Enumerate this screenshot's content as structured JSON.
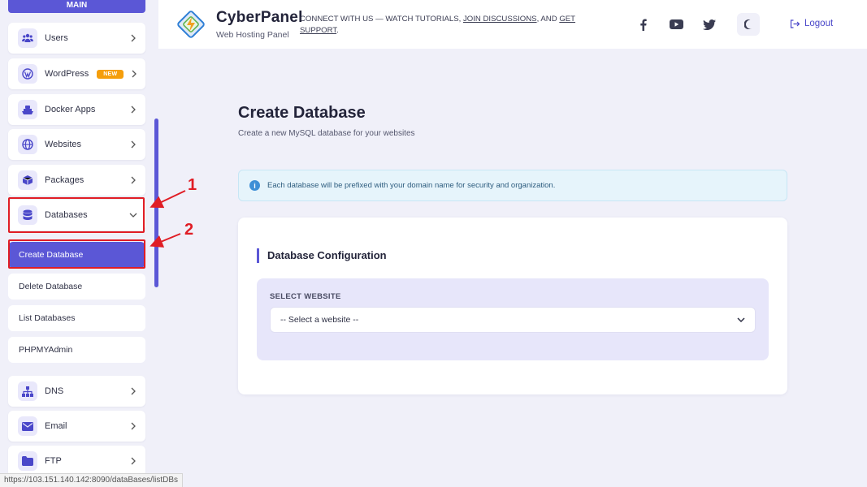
{
  "sidebar": {
    "section_label": "MAIN",
    "items": [
      {
        "label": "Users",
        "icon": "users-icon"
      },
      {
        "label": "WordPress",
        "icon": "wordpress-icon",
        "badge": "NEW"
      },
      {
        "label": "Docker Apps",
        "icon": "docker-icon"
      },
      {
        "label": "Websites",
        "icon": "globe-icon"
      },
      {
        "label": "Packages",
        "icon": "package-icon"
      },
      {
        "label": "Databases",
        "icon": "database-icon"
      }
    ],
    "sub_items": [
      {
        "label": "Create Database",
        "active": true
      },
      {
        "label": "Delete Database"
      },
      {
        "label": "List Databases"
      },
      {
        "label": "PHPMYAdmin"
      }
    ],
    "items_bottom": [
      {
        "label": "DNS",
        "icon": "sitemap-icon"
      },
      {
        "label": "Email",
        "icon": "envelope-icon"
      },
      {
        "label": "FTP",
        "icon": "folder-icon"
      }
    ]
  },
  "header": {
    "brand_title": "CyberPanel",
    "brand_subtitle": "Web Hosting Panel",
    "tagline_prefix": "CONNECT WITH US — WATCH TUTORIALS, ",
    "tagline_link1": "JOIN DISCUSSIONS",
    "tagline_mid": ", AND ",
    "tagline_link2": "GET SUPPORT",
    "tagline_suffix": ".",
    "logout_label": "Logout"
  },
  "main": {
    "title": "Create Database",
    "subtitle": "Create a new MySQL database for your websites",
    "info_text": "Each database will be prefixed with your domain name for security and organization.",
    "card_title": "Database Configuration",
    "field_label": "SELECT WEBSITE",
    "select_value": "-- Select a website --"
  },
  "annotations": [
    "1",
    "2"
  ],
  "status_url": "https://103.151.140.142:8090/dataBases/listDBs",
  "colors": {
    "accent": "#5b57d6",
    "annotation": "#e01d25",
    "badge": "#f59e0b",
    "background": "#f0f0f9"
  }
}
